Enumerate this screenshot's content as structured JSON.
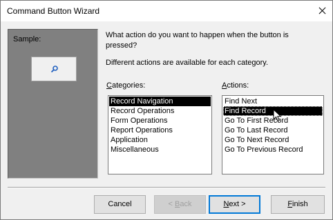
{
  "window": {
    "title": "Command Button Wizard"
  },
  "sample": {
    "label": "Sample:",
    "button_icon": "magnifier-icon"
  },
  "prompt": {
    "question": "What action do you want to happen when the button is pressed?",
    "hint": "Different actions are available for each category."
  },
  "categories": {
    "label_accel": "C",
    "label_rest": "ategories:",
    "items": [
      "Record Navigation",
      "Record Operations",
      "Form Operations",
      "Report Operations",
      "Application",
      "Miscellaneous"
    ],
    "selected": "Record Navigation"
  },
  "actions": {
    "label_accel": "A",
    "label_rest": "ctions:",
    "items": [
      "Find Next",
      "Find Record",
      "Go To First Record",
      "Go To Last Record",
      "Go To Next Record",
      "Go To Previous Record"
    ],
    "selected": "Find Record"
  },
  "buttons": {
    "cancel": "Cancel",
    "back_pre": "< ",
    "back_accel": "B",
    "back_rest": "ack",
    "next_accel": "N",
    "next_rest": "ext >",
    "finish_accel": "F",
    "finish_rest": "inish"
  },
  "colors": {
    "focus": "#0078d7",
    "selection": "#000000"
  }
}
